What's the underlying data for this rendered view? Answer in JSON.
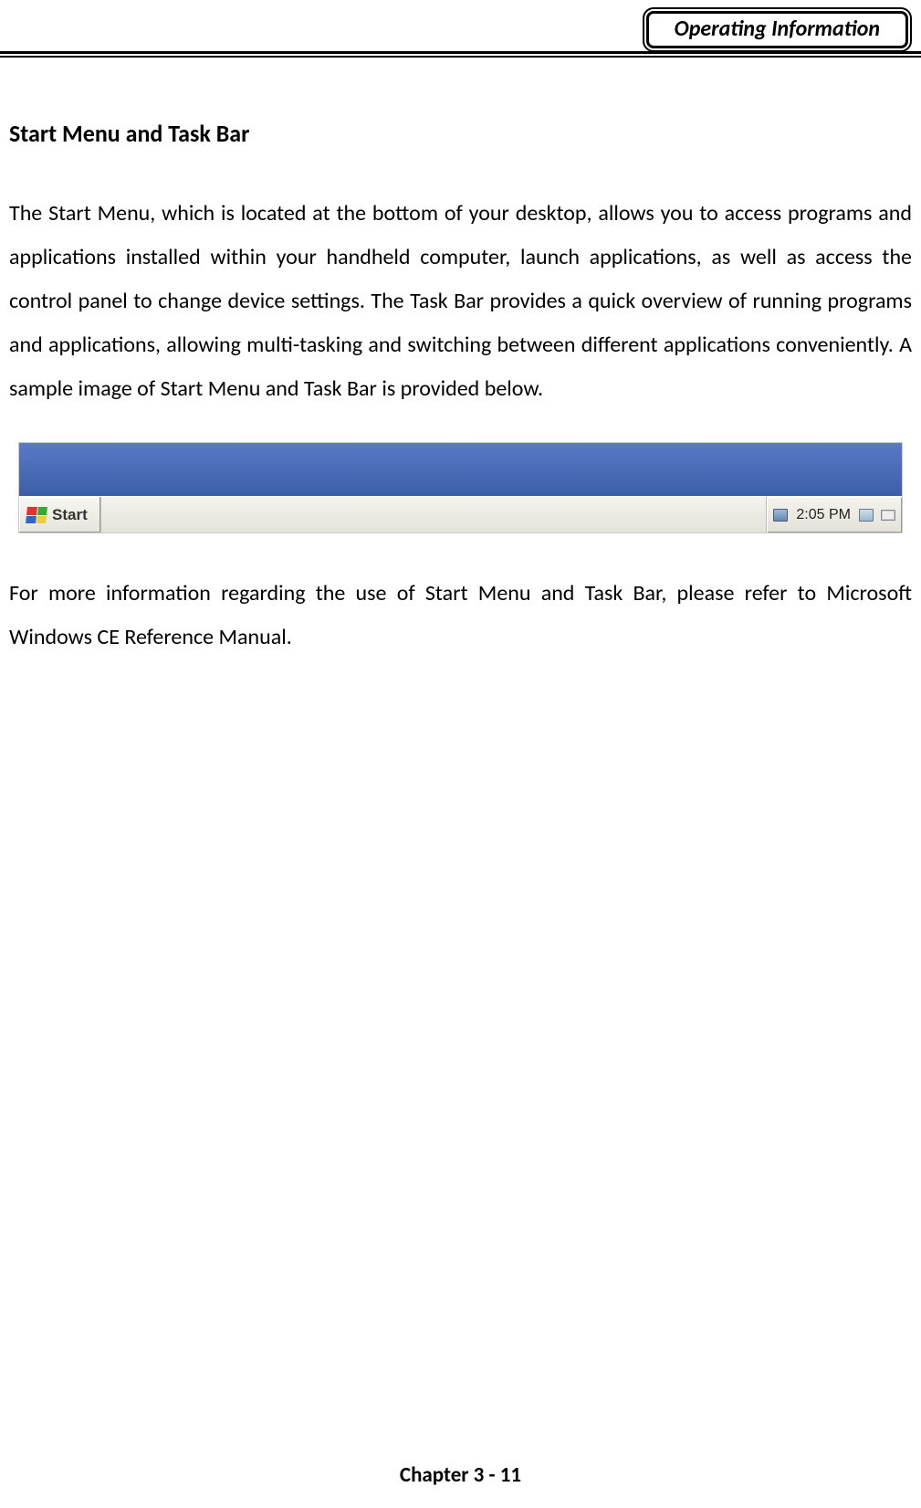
{
  "header": {
    "tab_label": "Operating Information"
  },
  "section": {
    "title": "Start Menu and Task Bar",
    "paragraph1": "The Start Menu, which is located at the bottom of your desktop, allows you to access programs and applications installed within your handheld computer, launch applications, as well as access the control panel to change device settings. The Task Bar provides a quick overview of running programs and applications, allowing multi-tasking and switching between different applications conveniently. A sample image of Start Menu and Task Bar is provided below.",
    "paragraph2": "For more information regarding the use of Start Menu and Task Bar, please refer to Microsoft Windows CE Reference Manual."
  },
  "taskbar": {
    "start_label": "Start",
    "clock": "2:05 PM"
  },
  "footer": {
    "page_label": "Chapter 3 - 11"
  }
}
